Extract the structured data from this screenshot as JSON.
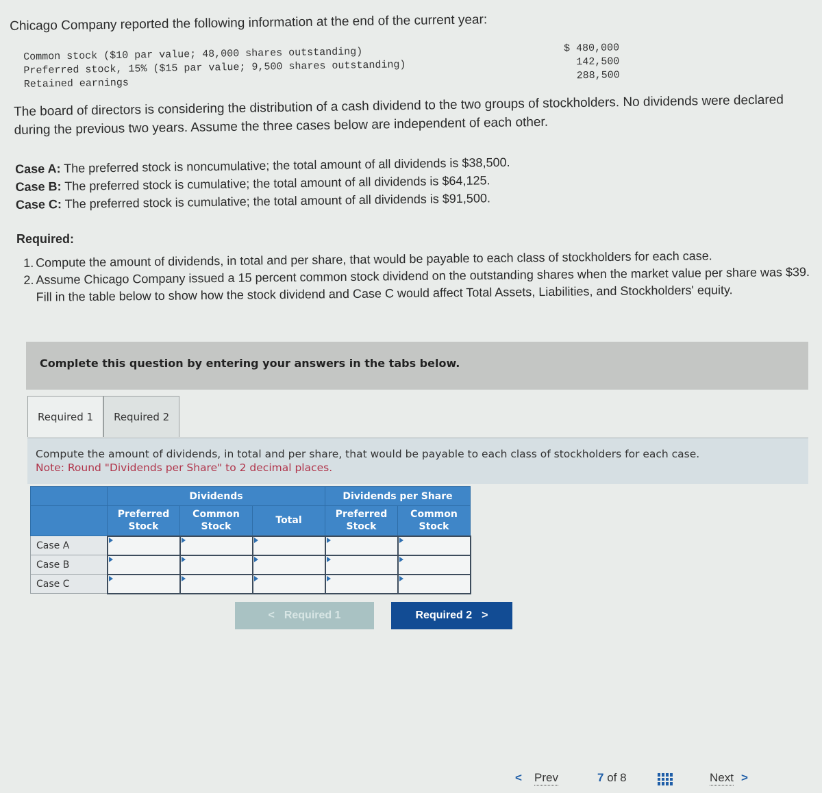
{
  "intro": "Chicago Company reported the following information at the end of the current year:",
  "facts": [
    {
      "label": "Common stock ($10 par value; 48,000 shares outstanding)",
      "value": "$ 480,000"
    },
    {
      "label": "Preferred stock, 15% ($15 par value; 9,500 shares outstanding)",
      "value": "142,500"
    },
    {
      "label": "Retained earnings",
      "value": "288,500"
    }
  ],
  "board_text": "The board of directors is considering the distribution of a cash dividend to the two groups of stockholders. No dividends were declared during the previous two years. Assume the three cases below are independent of each other.",
  "cases": [
    {
      "label": "Case A:",
      "text": " The preferred stock is noncumulative; the total amount of all dividends is $38,500."
    },
    {
      "label": "Case B:",
      "text": " The preferred stock is cumulative; the total amount of all dividends is $64,125."
    },
    {
      "label": "Case C:",
      "text": " The preferred stock is cumulative; the total amount of all dividends is $91,500."
    }
  ],
  "required_heading": "Required:",
  "requirements": [
    {
      "num": "1.",
      "text": "Compute the amount of dividends, in total and per share, that would be payable to each class of stockholders for each case."
    },
    {
      "num": "2.",
      "text": "Assume Chicago Company issued a 15 percent common stock dividend on the outstanding shares when the market value per share was $39. Fill in the table below to show how the stock dividend and Case C would affect Total Assets, Liabilities, and Stockholders' equity."
    }
  ],
  "banner": "Complete this question by entering your answers in the tabs below.",
  "tabs": [
    {
      "label": "Required 1",
      "active": true
    },
    {
      "label": "Required 2",
      "active": false
    }
  ],
  "instructions": {
    "main": "Compute the amount of dividends, in total and per share, that would be payable to each class of stockholders for each case.",
    "note": "Note: Round \"Dividends per Share\" to 2 decimal places."
  },
  "table": {
    "group_headers": [
      "Dividends",
      "Dividends per Share"
    ],
    "columns": [
      "Preferred Stock",
      "Common Stock",
      "Total",
      "Preferred Stock",
      "Common Stock"
    ],
    "rows": [
      {
        "label": "Case A",
        "values": [
          "",
          "",
          "",
          "",
          ""
        ]
      },
      {
        "label": "Case B",
        "values": [
          "",
          "",
          "",
          "",
          ""
        ]
      },
      {
        "label": "Case C",
        "values": [
          "",
          "",
          "",
          "",
          ""
        ]
      }
    ]
  },
  "nav_buttons": {
    "prev_label": "Required 1",
    "next_label": "Required 2",
    "prev_icon": "chevron-left",
    "next_icon": "chevron-right"
  },
  "footer": {
    "prev_label": "Prev",
    "current_page": "7",
    "of_label": "of",
    "total_pages": "8",
    "next_label": "Next",
    "prev_icon": "chevron-left",
    "next_icon": "chevron-right",
    "grid_icon": "grid-icon"
  },
  "colors": {
    "header_blue": "#3f86c8",
    "primary_button": "#124c94",
    "disabled_button": "#a9c2c3",
    "note_red": "#b0344a",
    "banner_gray": "#c4c6c4"
  }
}
